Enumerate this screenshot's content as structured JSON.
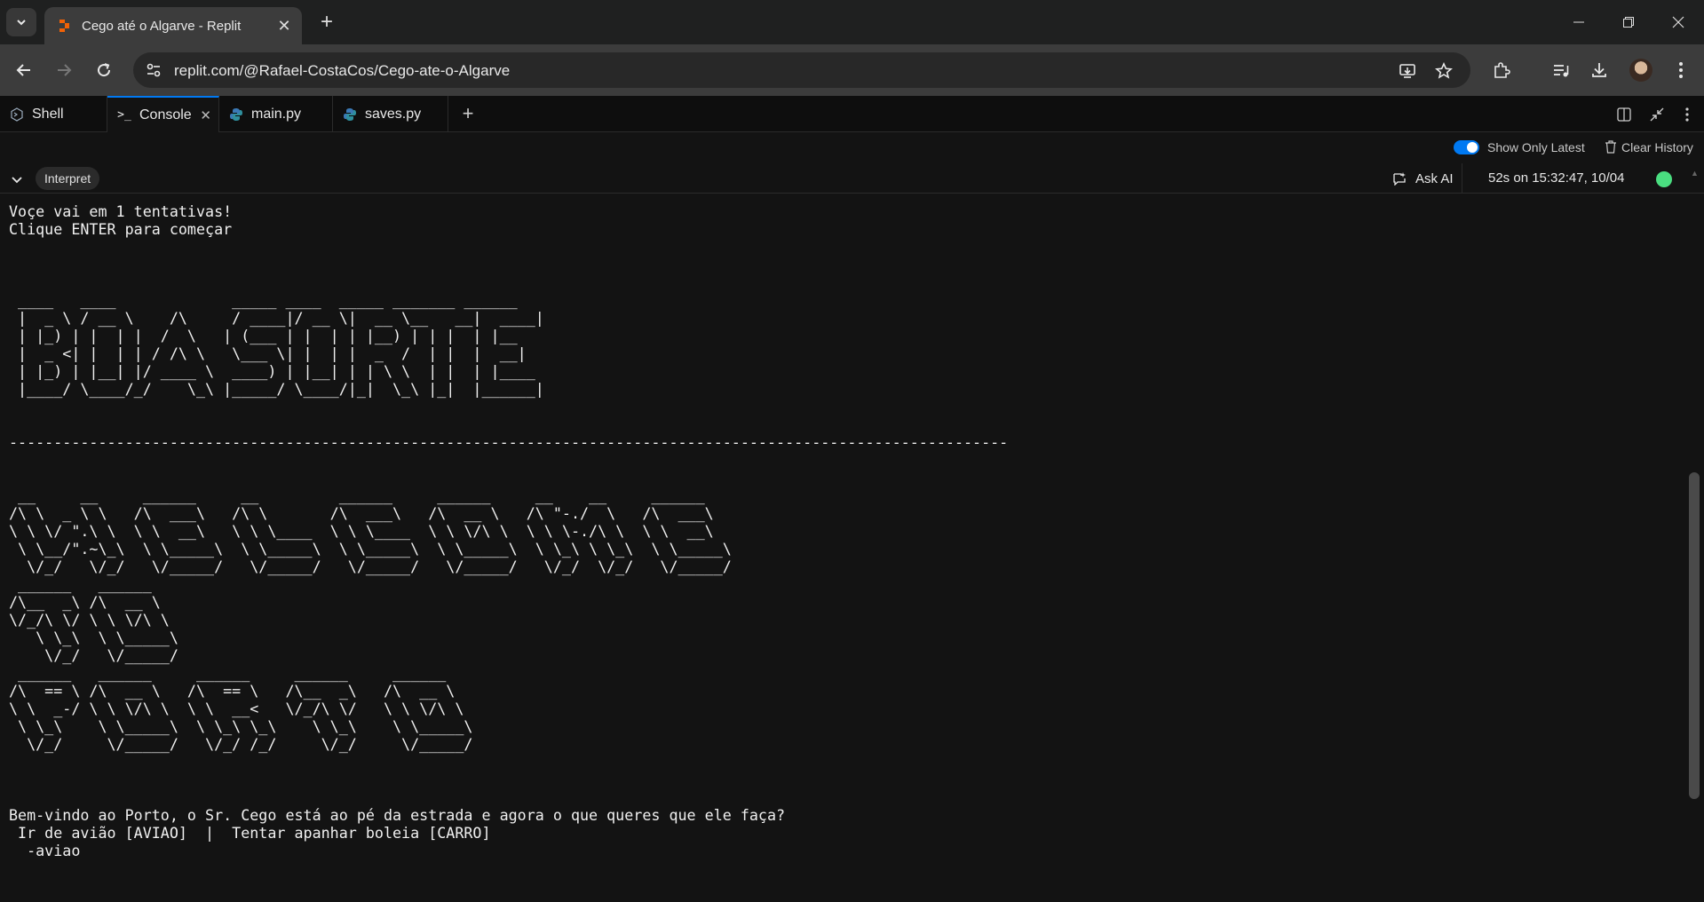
{
  "browser": {
    "tab_title": "Cego até o Algarve - Replit",
    "url": "replit.com/@Rafael-CostaCos/Cego-ate-o-Algarve",
    "accent": "#f26207"
  },
  "replit_tabs": {
    "shell": "Shell",
    "console": "Console",
    "main": "main.py",
    "saves": "saves.py"
  },
  "history": {
    "show_only_latest": "Show Only Latest",
    "show_only_latest_on": true,
    "clear_history": "Clear History"
  },
  "run": {
    "interpret_label": "Interpret",
    "ask_ai_label": "Ask AI",
    "run_info": "52s on 15:32:47, 10/04",
    "status_color": "#4ade80"
  },
  "console": {
    "output": "Voçe vai em 1 tentativas!\nClique ENTER para começar\n\n\n\n ____   ____             _____ ____  _____ _______ ______ \n |  _ \\ / __ \\    /\\     / ____|/ __ \\|  __ \\__   __|  ____|\n | |_) | |  | |  /  \\   | (___ | |  | | |__) | | |  | |__   \n |  _ <| |  | | / /\\ \\   \\___ \\| |  | |  _  /  | |  |  __|  \n | |_) | |__| |/ ____ \\  ____) | |__| | | \\ \\  | |  | |____ \n |____/ \\____/_/    \\_\\ |_____/ \\____/|_|  \\_\\ |_|  |______|\n\n\n----------------------------------------------------------------------------------------------------------------\n\n\n __     __     ______     __         ______     ______     __    __     ______    \n/\\ \\  _ \\ \\   /\\  ___\\   /\\ \\       /\\  ___\\   /\\  __ \\   /\\ \"-./  \\   /\\  ___\\   \n\\ \\ \\/ \".\\ \\  \\ \\  __\\   \\ \\ \\____  \\ \\ \\____  \\ \\ \\/\\ \\  \\ \\ \\-./\\ \\  \\ \\  __\\   \n \\ \\__/\".~\\_\\  \\ \\_____\\  \\ \\_____\\  \\ \\_____\\  \\ \\_____\\  \\ \\_\\ \\ \\_\\  \\ \\_____\\ \n  \\/_/   \\/_/   \\/_____/   \\/_____/   \\/_____/   \\/_____/   \\/_/  \\/_/   \\/_____/ \n ______   ______    \n/\\__  _\\ /\\  __ \\   \n\\/_/\\ \\/ \\ \\ \\/\\ \\  \n   \\ \\_\\  \\ \\_____\\ \n    \\/_/   \\/_____/ \n ______   ______     ______     ______     ______    \n/\\  == \\ /\\  __ \\   /\\  == \\   /\\__  _\\   /\\  __ \\   \n\\ \\  _-/ \\ \\ \\/\\ \\  \\ \\  __<   \\/_/\\ \\/   \\ \\ \\/\\ \\  \n \\ \\_\\    \\ \\_____\\  \\ \\_\\ \\_\\    \\ \\_\\    \\ \\_____\\ \n  \\/_/     \\/_____/   \\/_/ /_/     \\/_/     \\/_____/ \n\n\n\nBem-vindo ao Porto, o Sr. Cego está ao pé da estrada e agora o que queres que ele faça?\n Ir de avião [AVIAO]  |  Tentar apanhar boleia [CARRO]\n  -aviao"
  }
}
